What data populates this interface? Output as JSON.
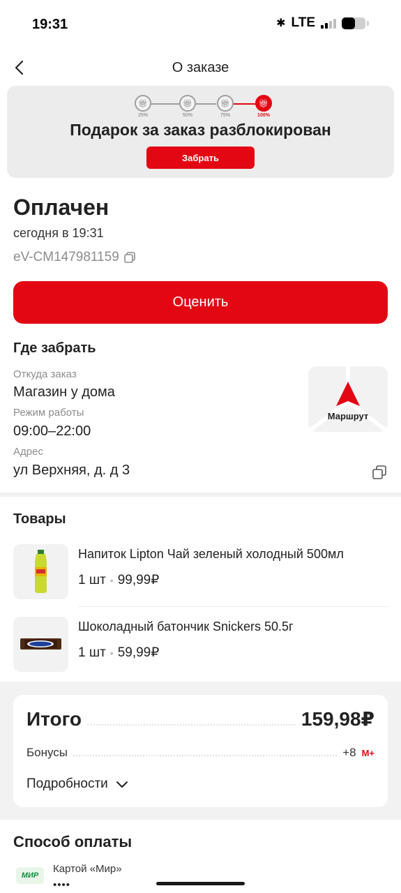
{
  "status_bar": {
    "time": "19:31",
    "network": "LTE",
    "bluetooth_icon": "bluetooth-icon",
    "battery_icon": "battery-icon"
  },
  "nav": {
    "title": "О заказе",
    "back_icon": "chevron-left-icon"
  },
  "gift_banner": {
    "steps": [
      {
        "label": "25%",
        "done": false
      },
      {
        "label": "50%",
        "done": false
      },
      {
        "label": "75%",
        "done": false
      },
      {
        "label": "100%",
        "done": true
      }
    ],
    "title": "Подарок за заказ разблокирован",
    "button_label": "Забрать"
  },
  "order": {
    "status": "Оплачен",
    "date": "сегодня в 19:31",
    "id": "eV-CM147981159",
    "rate_button": "Оценить"
  },
  "pickup": {
    "heading": "Где забрать",
    "from_label": "Откуда заказ",
    "from_value": "Магазин у дома",
    "hours_label": "Режим работы",
    "hours_value": "09:00–22:00",
    "address_label": "Адрес",
    "address_value": "ул Верхняя, д. д 3",
    "route_label": "Маршрут"
  },
  "products": {
    "heading": "Товары",
    "items": [
      {
        "name": "Напиток Lipton Чай зеленый холодный 500мл",
        "qty": "1 шт",
        "price": "99,99₽"
      },
      {
        "name": "Шоколадный батончик Snickers 50.5г",
        "qty": "1 шт",
        "price": "59,99₽"
      }
    ]
  },
  "totals": {
    "total_label": "Итого",
    "total_value": "159,98₽",
    "bonus_label": "Бонусы",
    "bonus_value": "+8",
    "bonus_badge": "M+",
    "details_label": "Подробности"
  },
  "payment": {
    "heading": "Способ оплаты",
    "logo_text": "МИР",
    "method": "Картой «Мир»",
    "mask": "••••"
  },
  "colors": {
    "accent": "#e30613",
    "muted": "#8c8c8c",
    "panel": "#f2f2f2"
  }
}
